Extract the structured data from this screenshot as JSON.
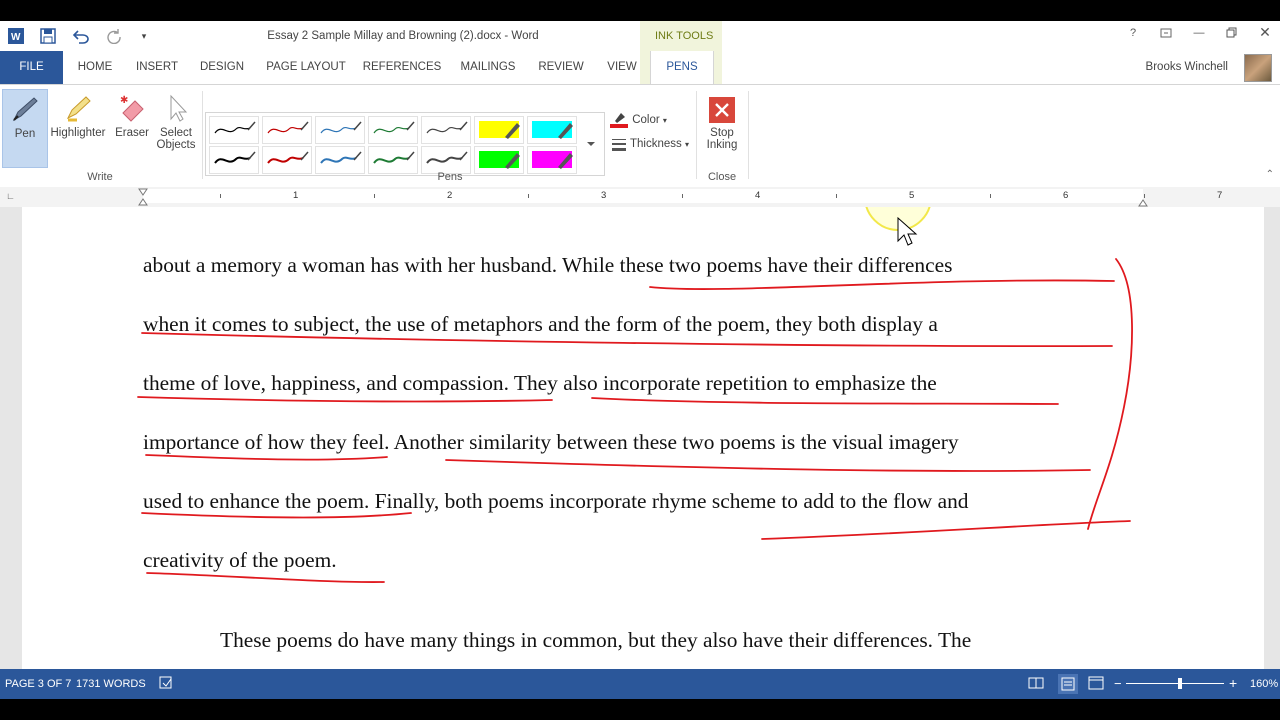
{
  "window": {
    "title": "Essay 2 Sample Millay and Browning (2).docx - Word",
    "context_tab_group": "INK TOOLS",
    "user": "Brooks Winchell"
  },
  "tabs": [
    {
      "label": "FILE"
    },
    {
      "label": "HOME"
    },
    {
      "label": "INSERT"
    },
    {
      "label": "DESIGN"
    },
    {
      "label": "PAGE LAYOUT"
    },
    {
      "label": "REFERENCES"
    },
    {
      "label": "MAILINGS"
    },
    {
      "label": "REVIEW"
    },
    {
      "label": "VIEW"
    },
    {
      "label": "PENS"
    }
  ],
  "ribbon": {
    "write": {
      "pen": "Pen",
      "highlighter": "Highlighter",
      "eraser": "Eraser",
      "select_line1": "Select",
      "select_line2": "Objects",
      "group": "Write"
    },
    "pens": {
      "group": "Pens",
      "color": "Color",
      "thickness": "Thickness"
    },
    "close": {
      "stop_line1": "Stop",
      "stop_line2": "Inking",
      "group": "Close"
    },
    "pen_colors": [
      "#000000",
      "#c00000",
      "#2e75b6",
      "#1e7b34",
      "#444444",
      "#ffff00",
      "#00ffff",
      "#000000",
      "#c00000",
      "#2e75b6",
      "#1e7b34",
      "#444444",
      "#00ff00",
      "#ff00ff"
    ]
  },
  "ruler": {
    "numbers": [
      "1",
      "2",
      "3",
      "4",
      "5",
      "6",
      "7"
    ]
  },
  "document": {
    "lines": [
      "about a memory a woman has with her husband. While these two poems have their differences",
      "when it comes to subject, the use of metaphors and the form of the poem, they both display a",
      "theme of love, happiness, and compassion. They also incorporate repetition to emphasize the",
      "importance of how they feel. Another similarity between these two poems is the visual imagery",
      "used to enhance the poem. Finally, both poems incorporate rhyme scheme to add to the flow and",
      "creativity of the poem.",
      "These poems do have many things in common, but they also have their differences. The"
    ],
    "ink_color": "#e0191e"
  },
  "status_bar": {
    "page": "PAGE 3 OF 7",
    "words": "1731 WORDS",
    "zoom": "160%"
  }
}
